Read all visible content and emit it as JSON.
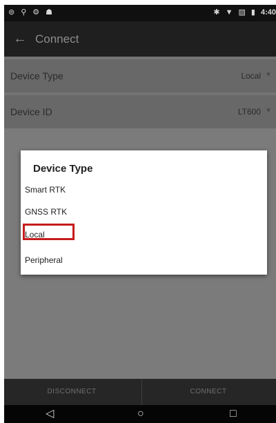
{
  "status_bar": {
    "left_icons": [
      "notification-icon",
      "usb-icon",
      "signal-icon",
      "android-icon"
    ],
    "left_glyphs": [
      "⊚",
      "⚲",
      "⚙",
      "☗"
    ],
    "right_icons": [
      "bluetooth-icon",
      "wifi-icon",
      "sim-icon",
      "battery-icon"
    ],
    "right_glyphs": [
      "✱",
      "▼",
      "▨",
      "▮"
    ],
    "time": "4:40"
  },
  "app_bar": {
    "back_glyph": "←",
    "title": "Connect"
  },
  "settings": [
    {
      "label": "Device Type",
      "value": "Local",
      "caret": "▼"
    },
    {
      "label": "Device ID",
      "value": "LT600",
      "caret": "▼"
    }
  ],
  "dialog": {
    "title": "Device Type",
    "options": [
      "Smart RTK",
      "GNSS RTK",
      "Local",
      "Peripheral"
    ],
    "highlighted": "Local"
  },
  "bottom_bar": {
    "disconnect_label": "DISCONNECT",
    "connect_label": "CONNECT"
  },
  "nav_bar": {
    "back_glyph": "◁",
    "home_glyph": "○",
    "recents_glyph": "□"
  },
  "colors": {
    "overlay": "#7b7b7b",
    "highlight": "#c51b1b"
  }
}
